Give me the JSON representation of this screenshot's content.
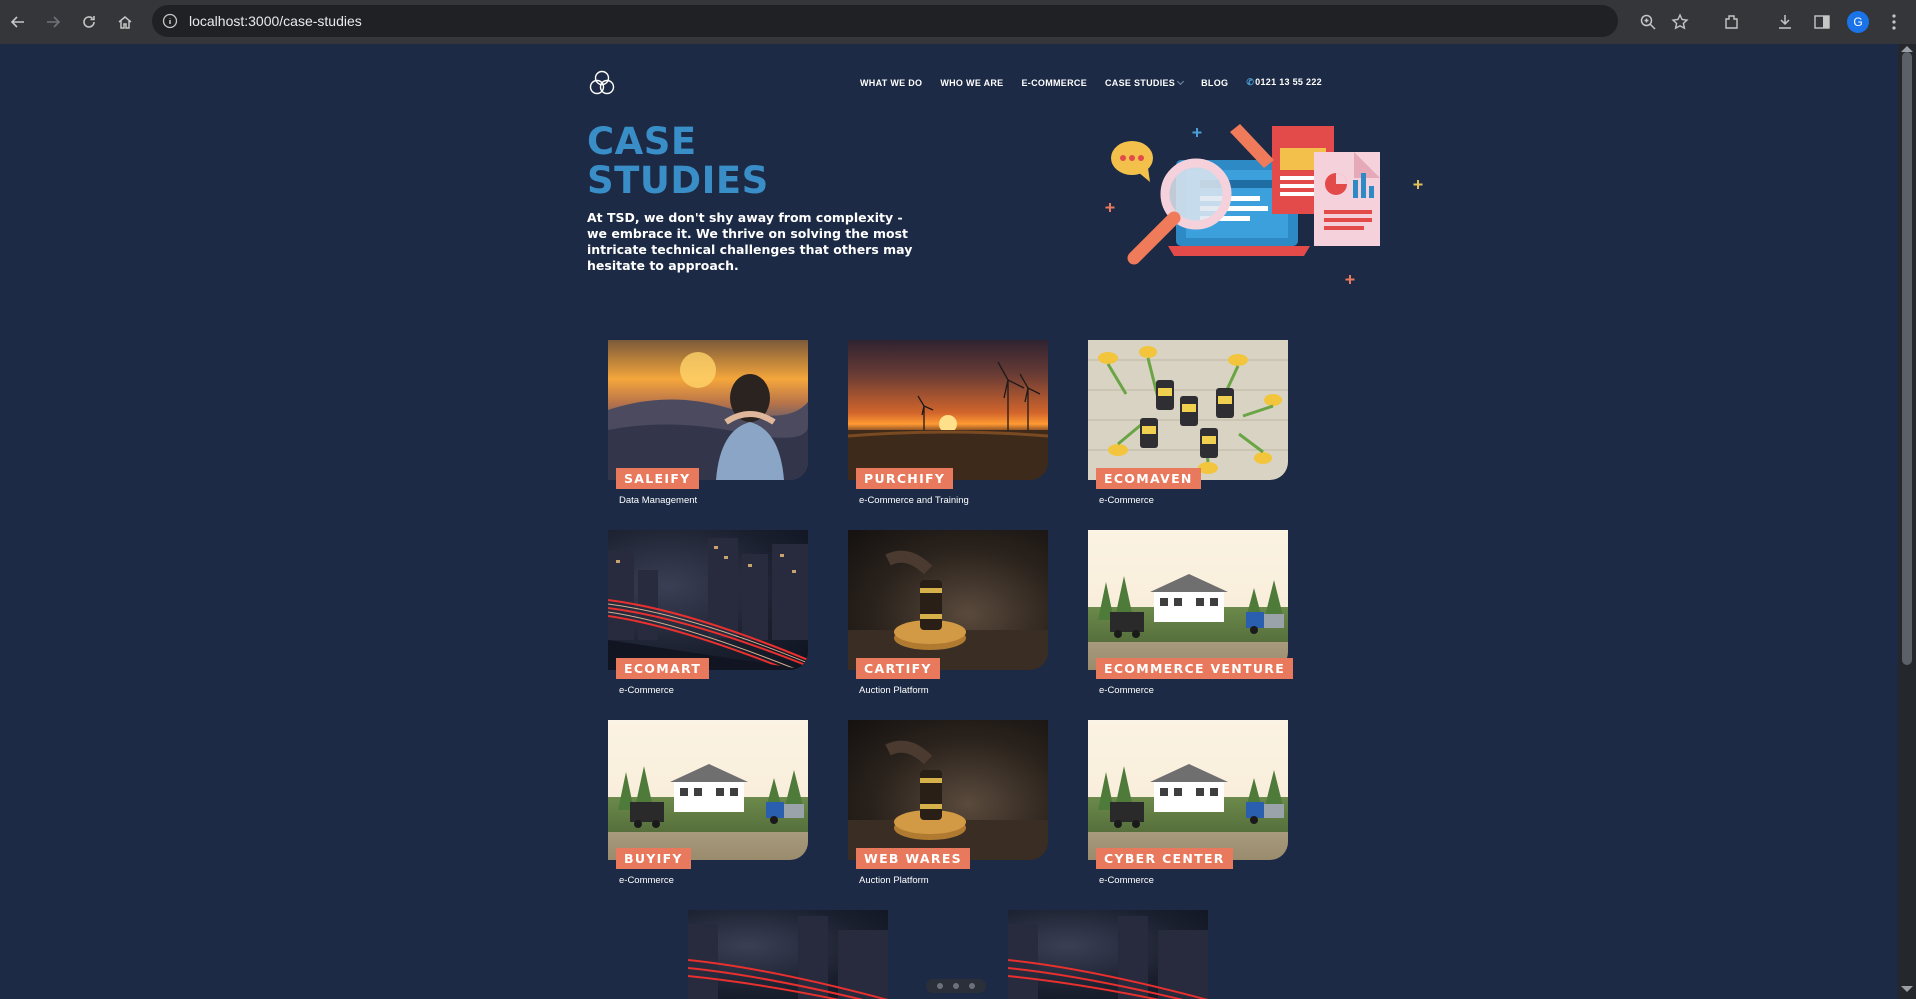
{
  "browser": {
    "url": "localhost:3000/case-studies",
    "profile_initial": "G",
    "icons": [
      "back-icon",
      "forward-icon",
      "reload-icon",
      "home-icon",
      "site-info-icon",
      "zoom-icon",
      "bookmark-star-icon",
      "extensions-icon",
      "download-icon",
      "side-panel-icon",
      "menu-dots-icon"
    ]
  },
  "nav": {
    "items": [
      "WHAT WE DO",
      "WHO WE ARE",
      "E-COMMERCE",
      "CASE STUDIES",
      "BLOG"
    ],
    "phone": "0121 13 55 222"
  },
  "hero": {
    "title_line1": "CASE",
    "title_line2": "STUDIES",
    "subtitle": "At TSD, we don't shy away from complexity - we embrace it. We thrive on solving the most intricate technical challenges that others may hesitate to approach."
  },
  "cards": [
    {
      "title": "SALEIFY",
      "category": "Data Management",
      "image": "sunset-person"
    },
    {
      "title": "PURCHIFY",
      "category": "e-Commerce and Training",
      "image": "wind-turbines"
    },
    {
      "title": "ECOMAVEN",
      "category": "e-Commerce",
      "image": "flowers-products"
    },
    {
      "title": "ECOMART",
      "category": "e-Commerce",
      "image": "city-lights"
    },
    {
      "title": "CARTIFY",
      "category": "Auction Platform",
      "image": "gavel"
    },
    {
      "title": "ECOMMERCE VENTURE",
      "category": "e-Commerce",
      "image": "farm-illustration"
    },
    {
      "title": "BUYIFY",
      "category": "e-Commerce",
      "image": "farm-illustration"
    },
    {
      "title": "WEB WARES",
      "category": "Auction Platform",
      "image": "gavel"
    },
    {
      "title": "CYBER CENTER",
      "category": "e-Commerce",
      "image": "farm-illustration"
    }
  ],
  "colors": {
    "page_bg": "#1c2a45",
    "accent_blue": "#3a8ec8",
    "badge_orange": "#e8795d"
  }
}
